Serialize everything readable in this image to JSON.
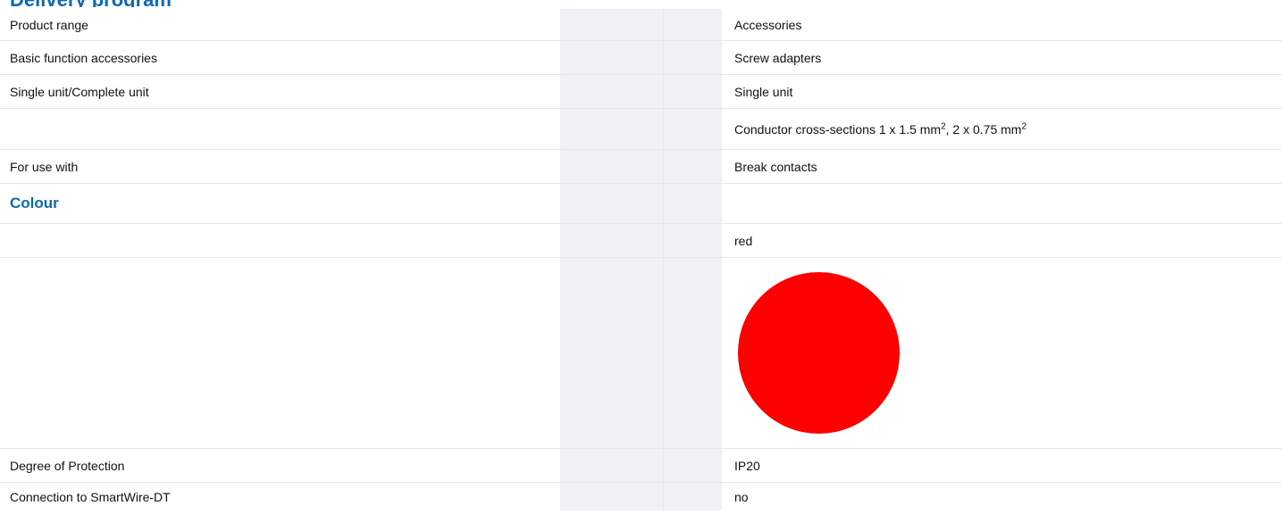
{
  "header": {
    "section_title_cut": "Delivery program"
  },
  "rows": [
    {
      "label": "Product range",
      "value": "Accessories"
    },
    {
      "label": "Basic function accessories",
      "value": "Screw adapters"
    },
    {
      "label": "Single unit/Complete unit",
      "value": "Single unit"
    },
    {
      "label": "",
      "value_parts": {
        "prefix": "Conductor cross-sections 1 x 1.5 mm",
        "sup1": "2",
        "mid": ", 2 x 0.75 mm",
        "sup2": "2"
      }
    },
    {
      "label": "For use with",
      "value": "Break contacts"
    }
  ],
  "colour_section": {
    "title": "Colour",
    "value": "red",
    "swatch_color": "#ff0000"
  },
  "rows_after": [
    {
      "label": "Degree of Protection",
      "value": "IP20"
    },
    {
      "label": "Connection to SmartWire-DT",
      "value": "no"
    }
  ],
  "colors": {
    "accent": "#0b69b6",
    "row_border": "#e5e7ea",
    "gray_column": "#f0f1f5"
  }
}
